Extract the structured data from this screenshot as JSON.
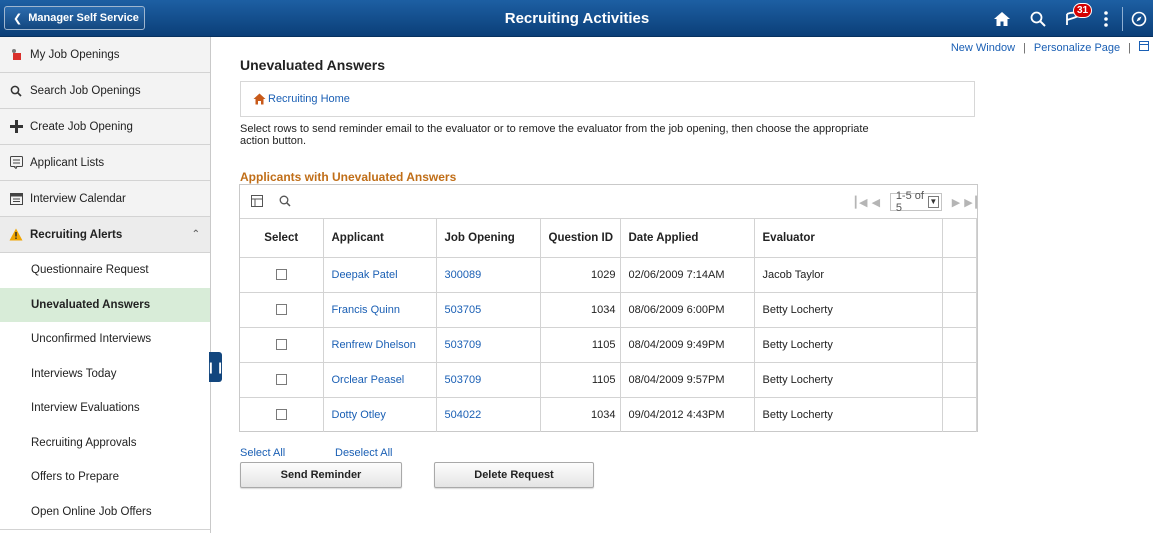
{
  "banner": {
    "back_label": "Manager Self Service",
    "title": "Recruiting Activities",
    "notification_count": "31",
    "icons": [
      "home-icon",
      "search-icon",
      "notifications-icon",
      "actions-menu-icon",
      "navbar-icon"
    ]
  },
  "sidebar": {
    "items": [
      {
        "label": "My Job Openings",
        "icon": "job-openings-icon"
      },
      {
        "label": "Search Job Openings",
        "icon": "search-icon"
      },
      {
        "label": "Create Job Opening",
        "icon": "plus-icon"
      },
      {
        "label": "Applicant Lists",
        "icon": "applicant-list-icon"
      },
      {
        "label": "Interview Calendar",
        "icon": "calendar-icon"
      }
    ],
    "group": {
      "label": "Recruiting Alerts",
      "icon": "warning-icon",
      "subitems": [
        {
          "label": "Questionnaire Request",
          "active": false
        },
        {
          "label": "Unevaluated Answers",
          "active": true
        },
        {
          "label": "Unconfirmed Interviews",
          "active": false
        },
        {
          "label": "Interviews Today",
          "active": false
        },
        {
          "label": "Interview Evaluations",
          "active": false
        },
        {
          "label": "Recruiting Approvals",
          "active": false
        },
        {
          "label": "Offers to Prepare",
          "active": false
        },
        {
          "label": "Open Online Job Offers",
          "active": false
        }
      ]
    }
  },
  "toplinks": {
    "new_window": "New Window",
    "personalize": "Personalize Page",
    "separator": "|"
  },
  "main": {
    "title": "Unevaluated Answers",
    "home_link": "Recruiting Home",
    "instructions": "Select rows to send reminder email to the evaluator or to remove the evaluator from the job opening, then choose the appropriate action button.",
    "grid_title": "Applicants with Unevaluated Answers",
    "pager": "1-5 of 5",
    "columns": [
      "Select",
      "Applicant",
      "Job Opening",
      "Question ID",
      "Date Applied",
      "Evaluator"
    ],
    "rows": [
      {
        "applicant": "Deepak Patel",
        "job_opening": "300089",
        "question_id": "1029",
        "date_applied": "02/06/2009 7:14AM",
        "evaluator": "Jacob Taylor"
      },
      {
        "applicant": "Francis Quinn",
        "job_opening": "503705",
        "question_id": "1034",
        "date_applied": "08/06/2009 6:00PM",
        "evaluator": "Betty Locherty"
      },
      {
        "applicant": "Renfrew Dhelson",
        "job_opening": "503709",
        "question_id": "1105",
        "date_applied": "08/04/2009 9:49PM",
        "evaluator": "Betty Locherty"
      },
      {
        "applicant": "Orclear Peasel",
        "job_opening": "503709",
        "question_id": "1105",
        "date_applied": "08/04/2009 9:57PM",
        "evaluator": "Betty Locherty"
      },
      {
        "applicant": "Dotty Otley",
        "job_opening": "504022",
        "question_id": "1034",
        "date_applied": "09/04/2012 4:43PM",
        "evaluator": "Betty Locherty"
      }
    ],
    "select_all": "Select All",
    "deselect_all": "Deselect All",
    "send_reminder": "Send Reminder",
    "delete_request": "Delete Request"
  },
  "colors": {
    "banner": "#0b3f78",
    "link": "#1a5fb4",
    "grid_title": "#c06e18",
    "active_nav": "#d8ecd8",
    "badge": "#d40000"
  }
}
